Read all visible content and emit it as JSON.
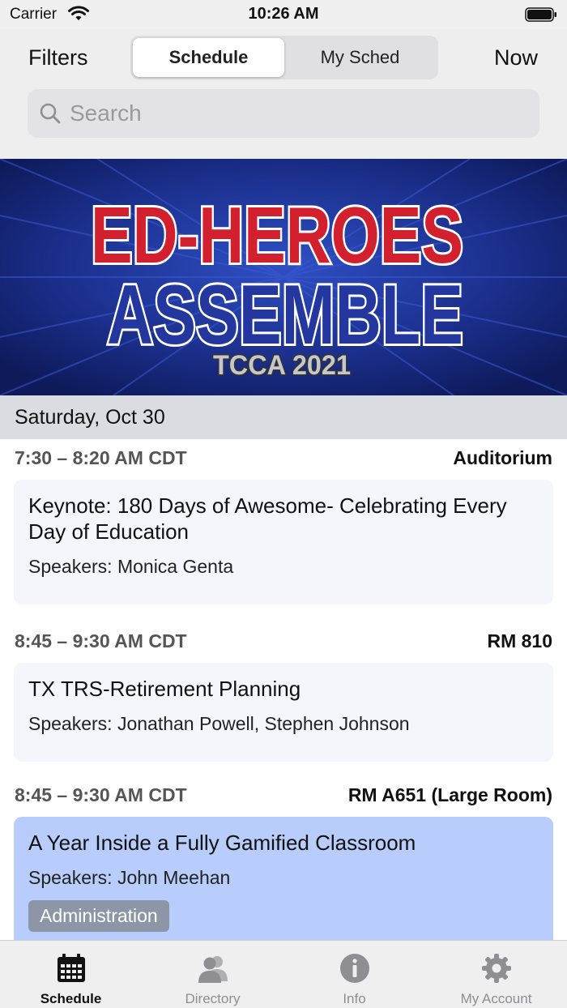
{
  "status": {
    "carrier": "Carrier",
    "time": "10:26 AM"
  },
  "nav": {
    "filters": "Filters",
    "now": "Now",
    "segments": [
      "Schedule",
      "My Sched"
    ],
    "search_placeholder": "Search"
  },
  "banner": {
    "line1": "ED-HEROES",
    "line2": "ASSEMBLE",
    "line3": "TCCA 2021"
  },
  "date_header": "Saturday, Oct 30",
  "sessions": [
    {
      "time": "7:30 – 8:20 AM CDT",
      "room": "Auditorium",
      "title": "Keynote: 180 Days of Awesome- Celebrating Every Day of Education",
      "speakers": "Speakers: Monica Genta"
    },
    {
      "time": "8:45 – 9:30 AM CDT",
      "room": "RM 810",
      "title": "TX TRS-Retirement Planning",
      "speakers": "Speakers: Jonathan Powell, Stephen Johnson"
    },
    {
      "time": "8:45 – 9:30 AM CDT",
      "room": "RM A651 (Large Room)",
      "title": "A Year Inside a Fully Gamified Classroom",
      "speakers": "Speakers: John Meehan",
      "tag": "Administration"
    }
  ],
  "tabs": [
    {
      "label": "Schedule",
      "icon": "calendar-icon"
    },
    {
      "label": "Directory",
      "icon": "people-icon"
    },
    {
      "label": "Info",
      "icon": "info-icon"
    },
    {
      "label": "My Account",
      "icon": "gear-icon"
    }
  ],
  "colors": {
    "highlight_card": "#b8cdfb",
    "banner_blue": "#1b2f8c",
    "banner_red": "#d3202e",
    "tag_bg": "#8c96a6"
  }
}
